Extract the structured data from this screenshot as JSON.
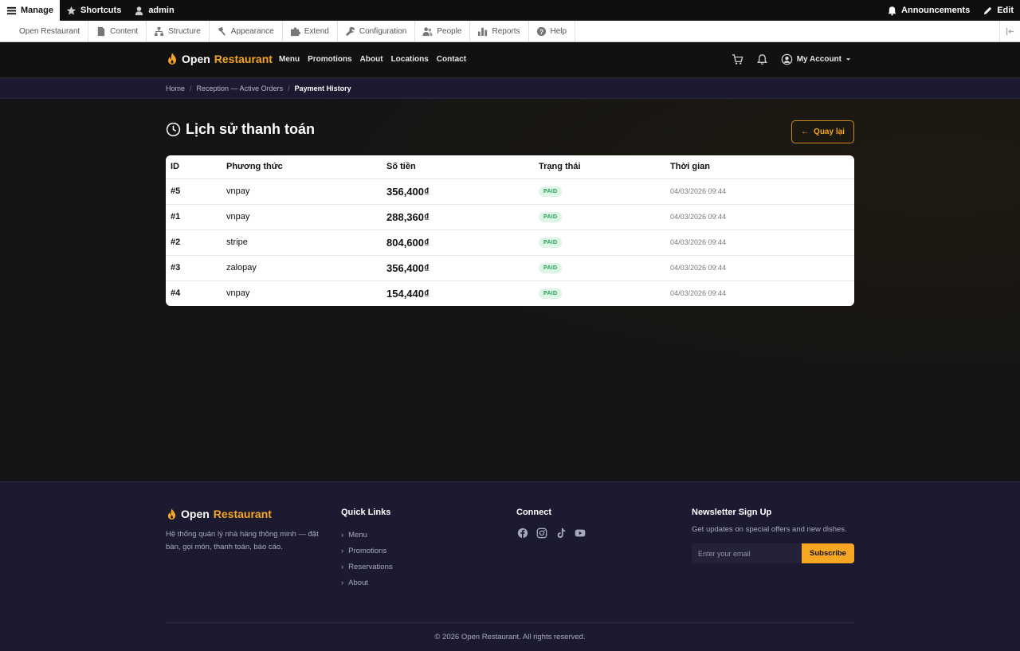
{
  "toolbar": {
    "manage": "Manage",
    "shortcuts": "Shortcuts",
    "user": "admin",
    "announcements": "Announcements",
    "edit": "Edit",
    "sub": [
      "Open Restaurant",
      "Content",
      "Structure",
      "Appearance",
      "Extend",
      "Configuration",
      "People",
      "Reports",
      "Help"
    ]
  },
  "header": {
    "logo_word1": "Open",
    "logo_word2": "Restaurant",
    "nav": [
      "Menu",
      "Promotions",
      "About",
      "Locations",
      "Contact"
    ],
    "account": "My Account"
  },
  "breadcrumb": {
    "home": "Home",
    "parent": "Reception — Active Orders",
    "current": "Payment History"
  },
  "page": {
    "title": "Lịch sử thanh toán",
    "back_label": "Quay lại"
  },
  "table": {
    "headers": [
      "ID",
      "Phương thức",
      "Số tiền",
      "Trạng thái",
      "Thời gian"
    ],
    "rows": [
      {
        "id": "#5",
        "method": "vnpay",
        "amount": "356,400₫",
        "status": "PAID",
        "time": "04/03/2026 09:44"
      },
      {
        "id": "#1",
        "method": "vnpay",
        "amount": "288,360₫",
        "status": "PAID",
        "time": "04/03/2026 09:44"
      },
      {
        "id": "#2",
        "method": "stripe",
        "amount": "804,600₫",
        "status": "PAID",
        "time": "04/03/2026 09:44"
      },
      {
        "id": "#3",
        "method": "zalopay",
        "amount": "356,400₫",
        "status": "PAID",
        "time": "04/03/2026 09:44"
      },
      {
        "id": "#4",
        "method": "vnpay",
        "amount": "154,440₫",
        "status": "PAID",
        "time": "04/03/2026 09:44"
      }
    ]
  },
  "footer": {
    "logo_word1": "Open",
    "logo_word2": "Restaurant",
    "description": "Hệ thống quản lý nhà hàng thông minh — đặt bàn, gọi món, thanh toán, báo cáo.",
    "quick_links_title": "Quick Links",
    "quick_links": [
      "Menu",
      "Promotions",
      "Reservations",
      "About"
    ],
    "connect_title": "Connect",
    "socials": [
      "facebook-icon",
      "instagram-icon",
      "tiktok-icon",
      "youtube-icon"
    ],
    "newsletter_title": "Newsletter Sign Up",
    "newsletter_text": "Get updates on special offers and new dishes.",
    "email_placeholder": "Enter your email",
    "subscribe_label": "Subscribe",
    "copyright": "© 2026 Open Restaurant. All rights reserved."
  },
  "colors": {
    "accent": "#f5a623",
    "paid_badge_bg": "#dcf5e4",
    "paid_badge_text": "#2f9a56",
    "footer_bg": "#1c1a30"
  }
}
